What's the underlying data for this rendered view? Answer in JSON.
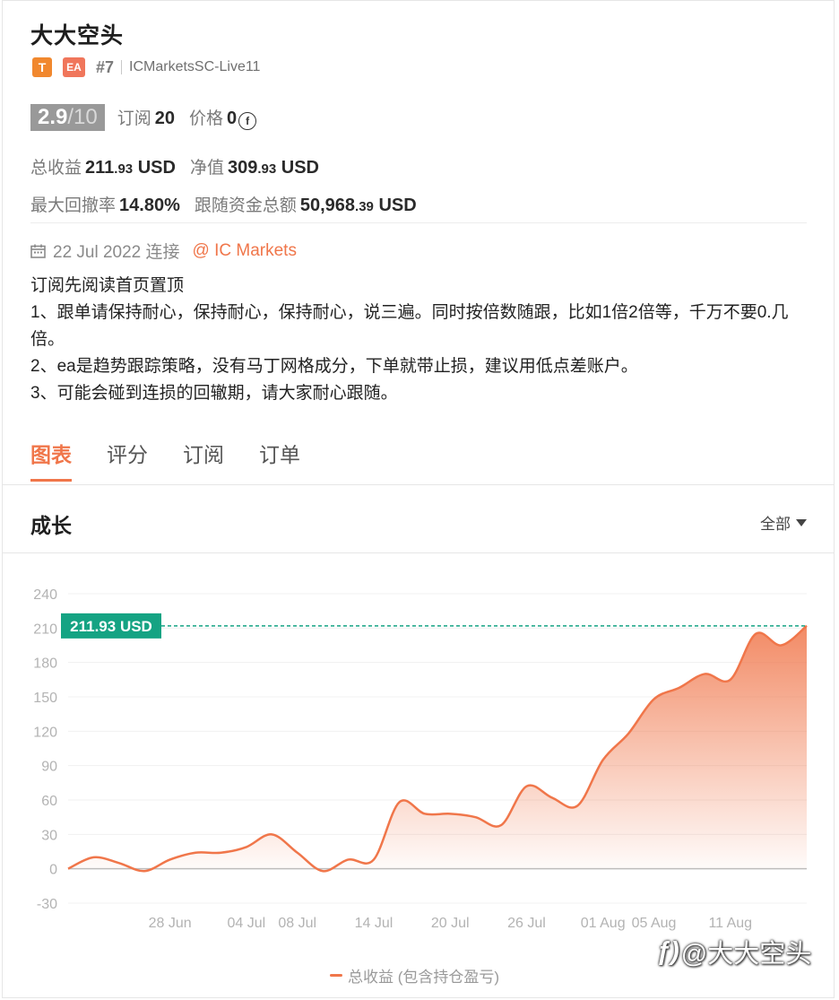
{
  "header": {
    "title": "大大空头",
    "badge_t": "T",
    "badge_ea": "EA",
    "rank": "#7",
    "server": "ICMarketsSC-Live11"
  },
  "stats": {
    "score": "2.9",
    "score_max": "/10",
    "subscribe_label": "订阅",
    "subscribe_value": "20",
    "price_label": "价格",
    "price_value": "0",
    "price_icon": "coin-icon",
    "total_profit_label": "总收益",
    "total_profit_int": "211",
    "total_profit_dec": ".93",
    "total_profit_unit": " USD",
    "equity_label": "净值",
    "equity_int": "309",
    "equity_dec": ".93",
    "equity_unit": " USD",
    "max_drawdown_label": "最大回撤率",
    "max_drawdown_value": "14.80%",
    "follow_funds_label": "跟随资金总额",
    "follow_funds_int": "50,968",
    "follow_funds_dec": ".39",
    "follow_funds_unit": " USD"
  },
  "connection": {
    "date": "22 Jul 2022 连接",
    "broker": "@ IC Markets"
  },
  "description": [
    "订阅先阅读首页置顶",
    "1、跟单请保持耐心，保持耐心，保持耐心，说三遍。同时按倍数随跟，比如1倍2倍等，千万不要0.几倍。",
    "2、ea是趋势跟踪策略，没有马丁网格成分，下单就带止损，建议用低点差账户。",
    "3、可能会碰到连损的回辙期，请大家耐心跟随。"
  ],
  "tabs": [
    {
      "label": "图表",
      "active": true
    },
    {
      "label": "评分",
      "active": false
    },
    {
      "label": "订阅",
      "active": false
    },
    {
      "label": "订单",
      "active": false
    }
  ],
  "section": {
    "title": "成长",
    "range_label": "全部"
  },
  "colors": {
    "accent": "#f0764a",
    "badge_t": "#f1882e",
    "badge_ea": "#f0765b",
    "marker": "#15a383"
  },
  "watermark": "@大大空头",
  "chart_data": {
    "type": "area",
    "x": [
      "2022-06-20",
      "2022-06-22",
      "2022-06-24",
      "2022-06-26",
      "2022-06-28",
      "2022-06-30",
      "2022-07-02",
      "2022-07-04",
      "2022-07-06",
      "2022-07-08",
      "2022-07-10",
      "2022-07-12",
      "2022-07-14",
      "2022-07-16",
      "2022-07-18",
      "2022-07-20",
      "2022-07-22",
      "2022-07-24",
      "2022-07-26",
      "2022-07-28",
      "2022-07-30",
      "2022-08-01",
      "2022-08-03",
      "2022-08-05",
      "2022-08-07",
      "2022-08-09",
      "2022-08-11",
      "2022-08-13",
      "2022-08-15",
      "2022-08-17"
    ],
    "series": [
      {
        "name": "总收益 (包含持仓盈亏)",
        "values": [
          0,
          10,
          5,
          -2,
          8,
          14,
          14,
          19,
          30,
          14,
          -2,
          8,
          8,
          58,
          48,
          48,
          45,
          38,
          72,
          62,
          55,
          95,
          118,
          148,
          158,
          170,
          165,
          205,
          195,
          212
        ]
      }
    ],
    "current_value": 211.93,
    "current_label": "211.93 USD",
    "y_ticks": [
      240,
      210,
      180,
      150,
      120,
      90,
      60,
      30,
      0,
      -30
    ],
    "ylim": [
      -30,
      240
    ],
    "x_ticks": [
      "28 Jun",
      "04 Jul",
      "08 Jul",
      "14 Jul",
      "20 Jul",
      "26 Jul",
      "01 Aug",
      "05 Aug",
      "11 Aug"
    ],
    "x_tick_dates": [
      "2022-06-28",
      "2022-07-04",
      "2022-07-08",
      "2022-07-14",
      "2022-07-20",
      "2022-07-26",
      "2022-08-01",
      "2022-08-05",
      "2022-08-11"
    ],
    "legend": "总收益 (包含持仓盈亏)",
    "legend_position": "bottom",
    "grid": true
  }
}
